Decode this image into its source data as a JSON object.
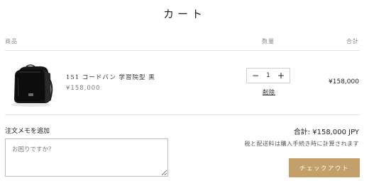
{
  "page": {
    "title": "カート"
  },
  "columns": {
    "product": "商品",
    "quantity": "数量",
    "total": "合計"
  },
  "item": {
    "name": "151 コードバン 学習院型 黒",
    "price": "¥158,000",
    "quantity": "1",
    "remove_label": "削除",
    "line_total": "¥158,000",
    "thumbnail": "black-leather-randoseru"
  },
  "icons": {
    "minus": "−",
    "plus": "+"
  },
  "note": {
    "label": "注文メモを追加",
    "placeholder": "お困りですか？"
  },
  "summary": {
    "subtotal": "合計: ¥158,000 JPY",
    "tax_note": "税と配送料は購入手続き時に計算されます",
    "checkout_label": "チェックアウト"
  },
  "colors": {
    "checkout_button": "#c3a06a",
    "divider": "#e3e3e3"
  }
}
